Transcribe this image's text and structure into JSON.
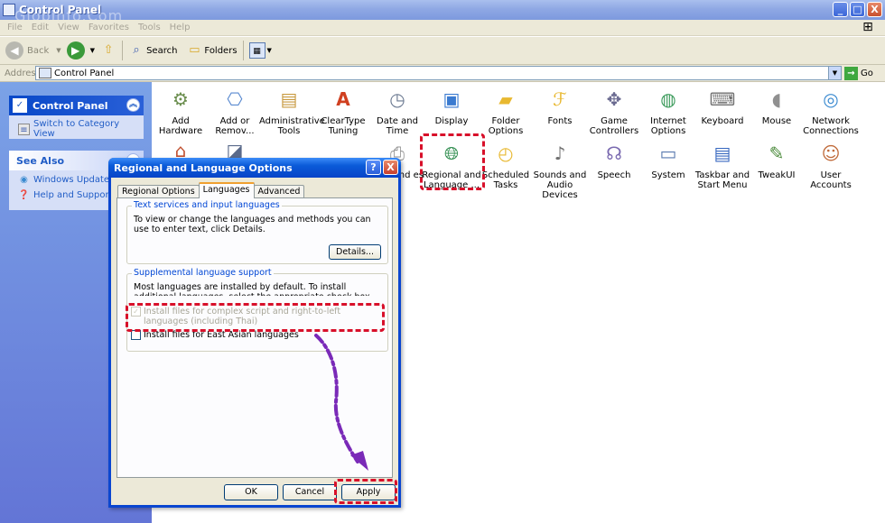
{
  "window": {
    "title": "Control Panel",
    "watermark": "Globinfo.Com",
    "controls": {
      "minimize": "_",
      "maximize": "□",
      "close": "X"
    }
  },
  "menubar": {
    "items": [
      "File",
      "Edit",
      "View",
      "Favorites",
      "Tools",
      "Help"
    ]
  },
  "toolbar": {
    "back": "Back",
    "search": "Search",
    "folders": "Folders"
  },
  "addressbar": {
    "label": "Address",
    "value": "Control Panel",
    "go": "Go"
  },
  "taskpane": {
    "panel_title": "Control Panel",
    "switch_link": "Switch to Category View",
    "see_also_title": "See Also",
    "see_also_links": [
      "Windows Update",
      "Help and Support"
    ]
  },
  "icons": [
    {
      "label": "Add Hardware",
      "icon": "add-hardware-icon",
      "color": "#6b8e4e"
    },
    {
      "label": "Add or Remov...",
      "icon": "add-remove-programs-icon",
      "color": "#5a8ad0"
    },
    {
      "label": "Administrative Tools",
      "icon": "administrative-tools-icon",
      "color": "#c89a40"
    },
    {
      "label": "ClearType Tuning",
      "icon": "cleartype-icon",
      "color": "#d04020"
    },
    {
      "label": "Date and Time",
      "icon": "date-time-icon",
      "color": "#9aa8c0"
    },
    {
      "label": "Display",
      "icon": "display-icon",
      "color": "#3a7ad0"
    },
    {
      "label": "Folder Options",
      "icon": "folder-options-icon",
      "color": "#e8c040"
    },
    {
      "label": "Fonts",
      "icon": "fonts-icon",
      "color": "#e8c040"
    },
    {
      "label": "Game Controllers",
      "icon": "game-controllers-icon",
      "color": "#8a8aa0"
    },
    {
      "label": "Internet Options",
      "icon": "internet-options-icon",
      "color": "#3a9a5a"
    },
    {
      "label": "Keyboard",
      "icon": "keyboard-icon",
      "color": "#909090"
    },
    {
      "label": "Mouse",
      "icon": "mouse-icon",
      "color": "#b0b0b0"
    },
    {
      "label": "Network Connections",
      "icon": "network-connections-icon",
      "color": "#3a8ad0"
    },
    {
      "label": "and es",
      "icon": "printers-faxes-icon",
      "color": "#a0a0a0"
    },
    {
      "label": "Regional and Language ...",
      "icon": "regional-language-icon",
      "color": "#2a8a4a"
    },
    {
      "label": "Scheduled Tasks",
      "icon": "scheduled-tasks-icon",
      "color": "#e8c040"
    },
    {
      "label": "Sounds and Audio Devices",
      "icon": "sounds-audio-icon",
      "color": "#808080"
    },
    {
      "label": "Speech",
      "icon": "speech-icon",
      "color": "#8a7ac0"
    },
    {
      "label": "System",
      "icon": "system-icon",
      "color": "#5a7ab0"
    },
    {
      "label": "Taskbar and Start Menu",
      "icon": "taskbar-start-icon",
      "color": "#3a6ac0"
    },
    {
      "label": "TweakUI",
      "icon": "tweakui-icon",
      "color": "#5a9a3a"
    },
    {
      "label": "User Accounts",
      "icon": "user-accounts-icon",
      "color": "#c06a3a"
    }
  ],
  "dialog": {
    "title": "Regional and Language Options",
    "help": "?",
    "close": "X",
    "tabs": [
      "Regional Options",
      "Languages",
      "Advanced"
    ],
    "active_tab": "Languages",
    "text_services": {
      "title": "Text services and input languages",
      "description": "To view or change the languages and methods you can use to enter text, click Details.",
      "details_button": "Details..."
    },
    "supplemental": {
      "title": "Supplemental language support",
      "description": "Most languages are installed by default. To install additional languages, select the appropriate check box below.",
      "complex_script_label": "Install files for complex script and right-to-left languages (including Thai)",
      "complex_script_checked": true,
      "east_asian_label": "Install files for East Asian languages",
      "east_asian_checked": false
    },
    "buttons": {
      "ok": "OK",
      "cancel": "Cancel",
      "apply": "Apply"
    }
  },
  "colors": {
    "highlight": "#d8102a",
    "arrow": "#7a2ab8",
    "xp_blue": "#0a46d0"
  }
}
